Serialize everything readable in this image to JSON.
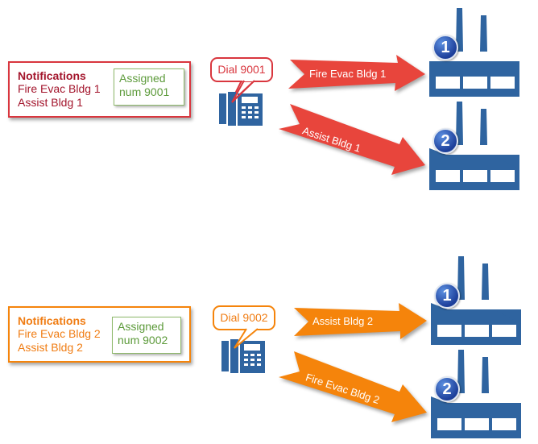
{
  "colors": {
    "scenario1": "#d9363e",
    "scenario1_text": "#a3152c",
    "scenario2": "#f5840b",
    "scenario2_text": "#f07d14",
    "assigned_border": "#8db86a",
    "assigned_text": "#5c9a3a",
    "icon_blue": "#2f64a0"
  },
  "scenarios": [
    {
      "notifications": {
        "title": "Notifications",
        "items": [
          "Fire Evac Bldg 1",
          "Assist Bldg 1"
        ]
      },
      "assigned": {
        "line1": "Assigned",
        "line2": "num 9001"
      },
      "dial": "Dial 9001",
      "arrows": [
        {
          "label": "Fire Evac Bldg 1",
          "target": 1
        },
        {
          "label": "Assist Bldg 1",
          "target": 2
        }
      ],
      "buildings": [
        {
          "badge": "1"
        },
        {
          "badge": "2"
        }
      ]
    },
    {
      "notifications": {
        "title": "Notifications",
        "items": [
          "Fire Evac Bldg 2",
          "Assist Bldg 2"
        ]
      },
      "assigned": {
        "line1": "Assigned",
        "line2": "num 9002"
      },
      "dial": "Dial 9002",
      "arrows": [
        {
          "label": "Assist Bldg 2",
          "target": 1
        },
        {
          "label": "Fire Evac Bldg 2",
          "target": 2
        }
      ],
      "buildings": [
        {
          "badge": "1"
        },
        {
          "badge": "2"
        }
      ]
    }
  ]
}
